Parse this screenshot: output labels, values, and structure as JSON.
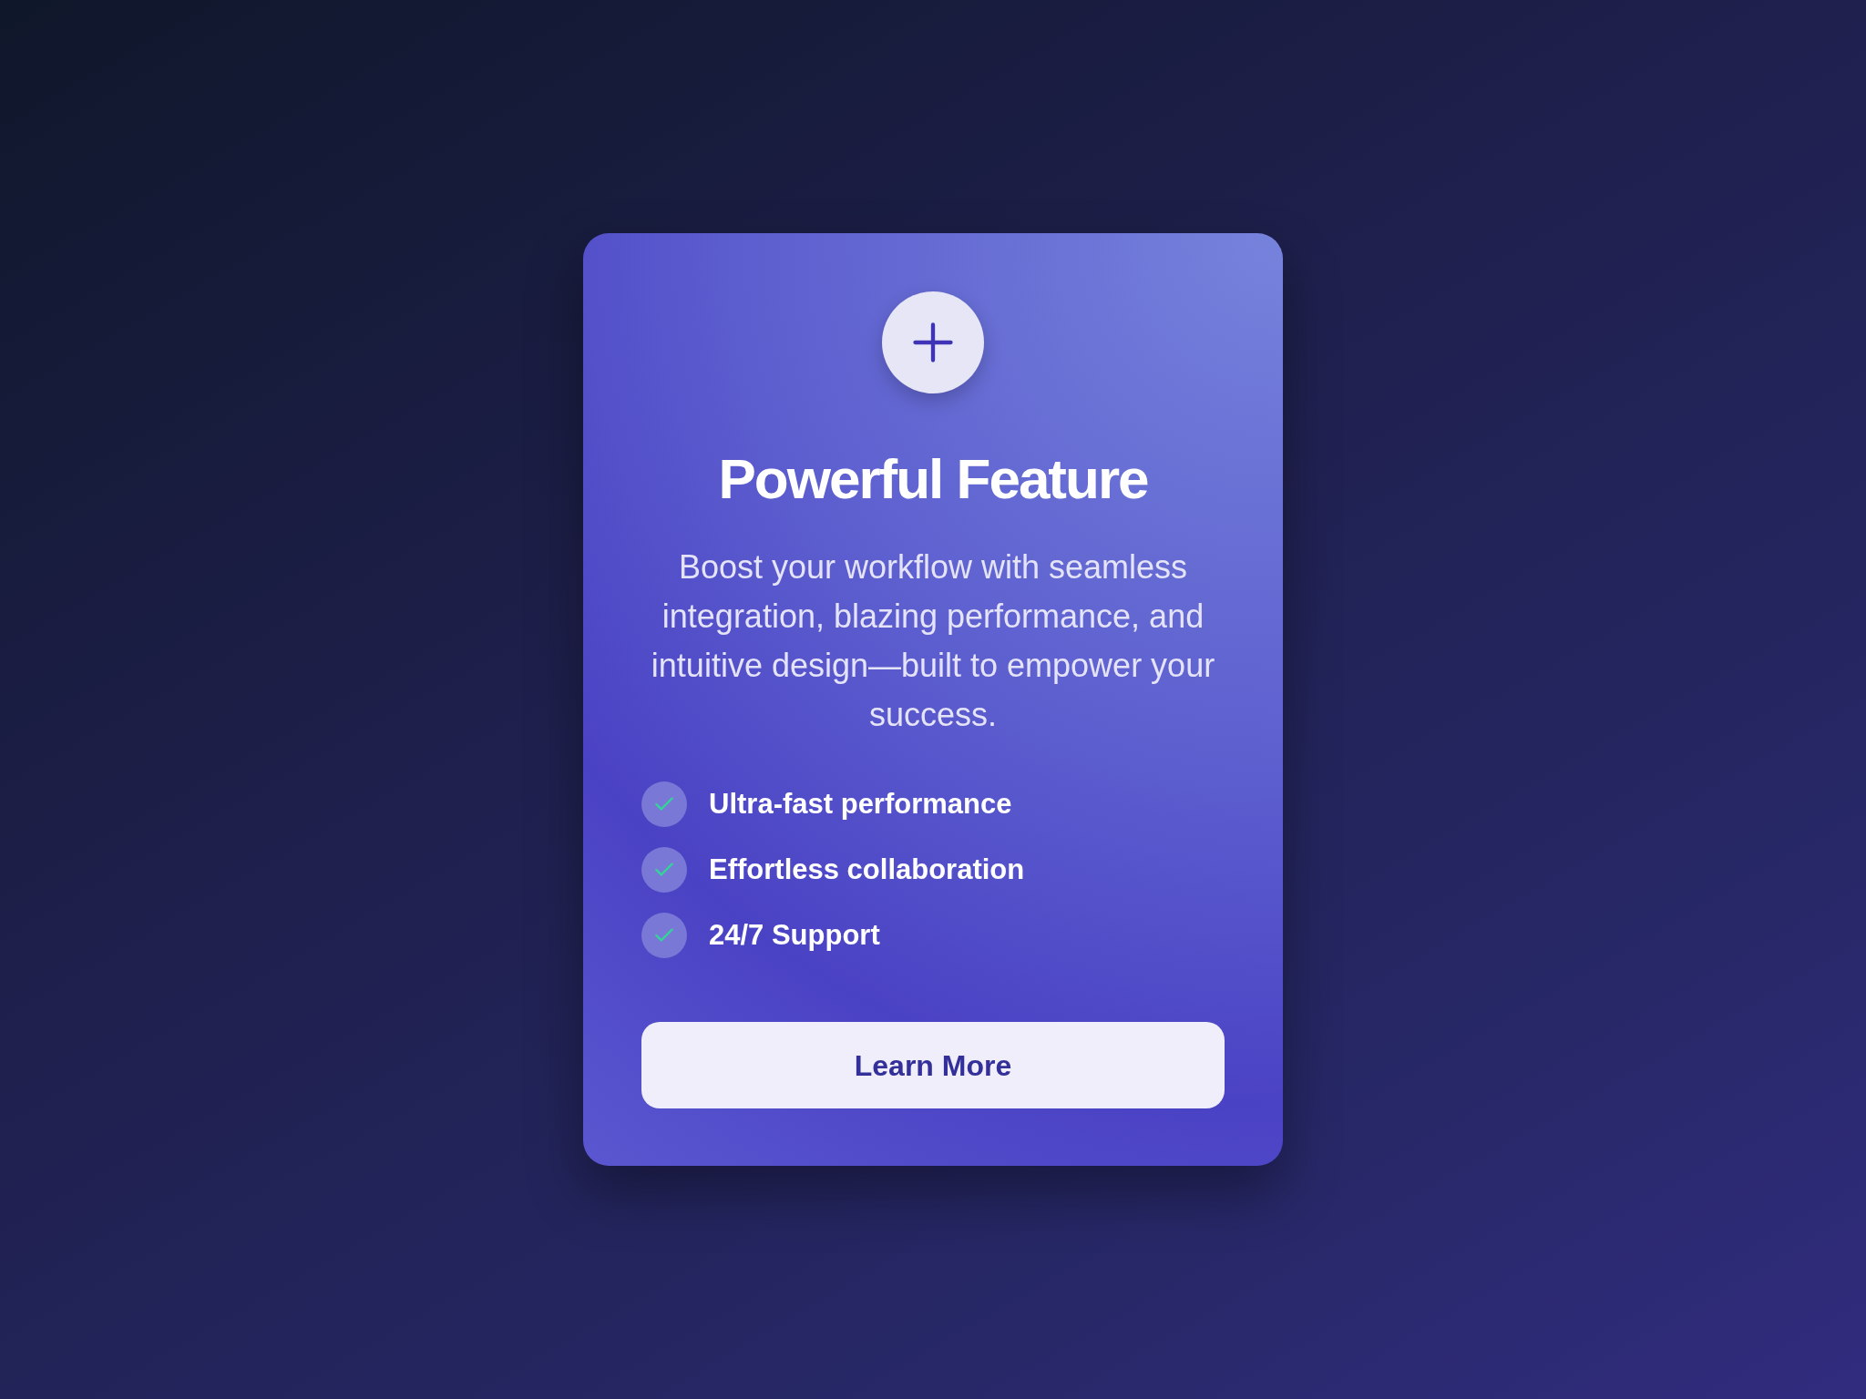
{
  "card": {
    "title": "Powerful Feature",
    "description": "Boost your workflow with seamless integration, blazing performance, and intuitive design—built to empower your success.",
    "features": [
      "Ultra-fast performance",
      "Effortless collaboration",
      "24/7 Support"
    ],
    "button": "Learn More"
  }
}
